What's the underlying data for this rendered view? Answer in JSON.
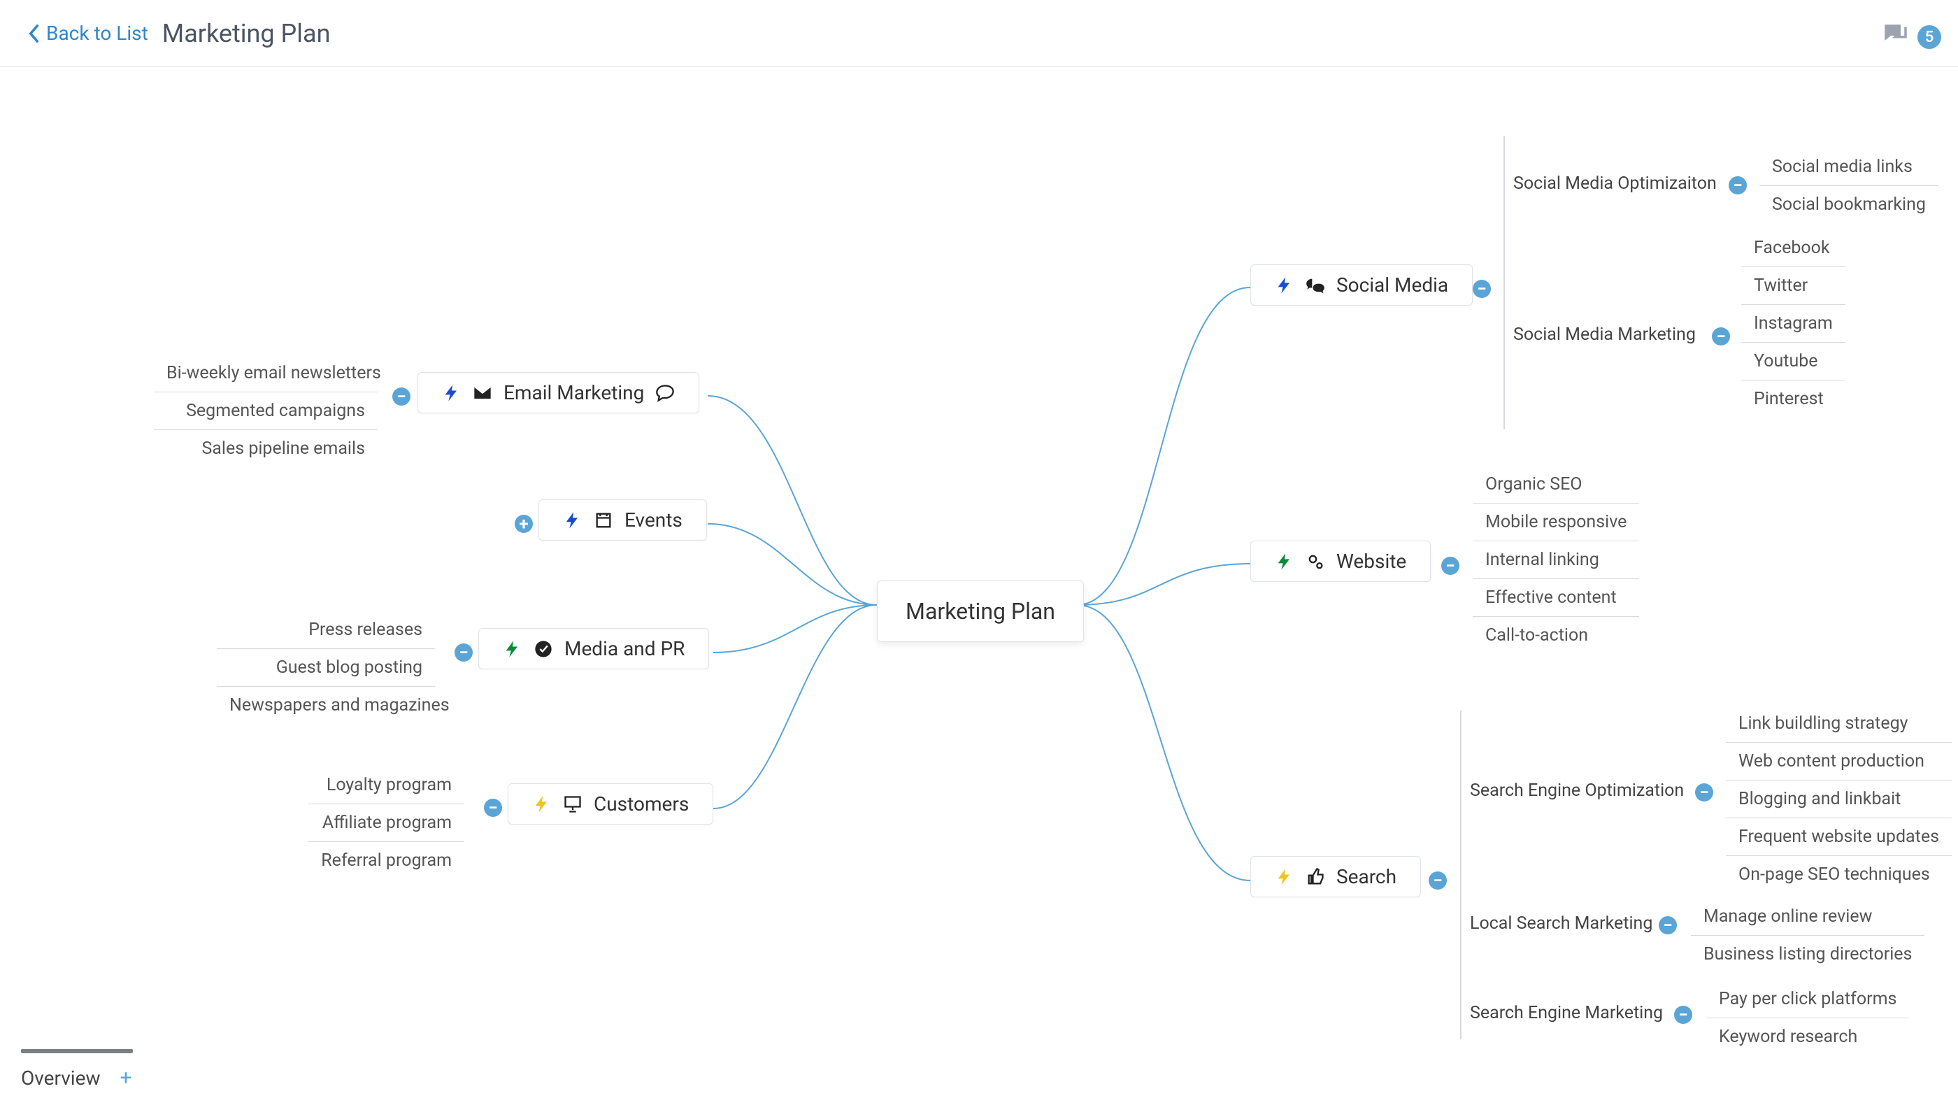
{
  "header": {
    "back_label": "Back to List",
    "title": "Marketing Plan",
    "comment_count": "5"
  },
  "bottom": {
    "tab_label": "Overview"
  },
  "root": {
    "label": "Marketing Plan"
  },
  "left": {
    "email": {
      "label": "Email Marketing",
      "items": [
        "Bi-weekly email newsletters",
        "Segmented campaigns",
        "Sales pipeline emails"
      ]
    },
    "events": {
      "label": "Events"
    },
    "media": {
      "label": "Media and PR",
      "items": [
        "Press releases",
        "Guest blog posting",
        "Newspapers and magazines"
      ]
    },
    "customers": {
      "label": "Customers",
      "items": [
        "Loyalty program",
        "Affiliate program",
        "Referral program"
      ]
    }
  },
  "right": {
    "social": {
      "label": "Social Media",
      "groups": [
        {
          "label": "Social Media Optimizaiton",
          "items": [
            "Social media links",
            "Social bookmarking"
          ]
        },
        {
          "label": "Social Media Marketing",
          "items": [
            "Facebook",
            "Twitter",
            "Instagram",
            "Youtube",
            "Pinterest"
          ]
        }
      ]
    },
    "website": {
      "label": "Website",
      "items": [
        "Organic SEO",
        "Mobile responsive",
        "Internal linking",
        "Effective content",
        "Call-to-action"
      ]
    },
    "search": {
      "label": "Search",
      "groups": [
        {
          "label": "Search Engine Optimization",
          "items": [
            "Link buildling strategy",
            "Web content production",
            "Blogging and linkbait",
            "Frequent website updates",
            "On-page SEO techniques"
          ]
        },
        {
          "label": "Local Search Marketing",
          "items": [
            "Manage online review",
            "Business listing directories"
          ]
        },
        {
          "label": "Search Engine Marketing",
          "items": [
            "Pay per click platforms",
            "Keyword research"
          ]
        }
      ]
    }
  }
}
